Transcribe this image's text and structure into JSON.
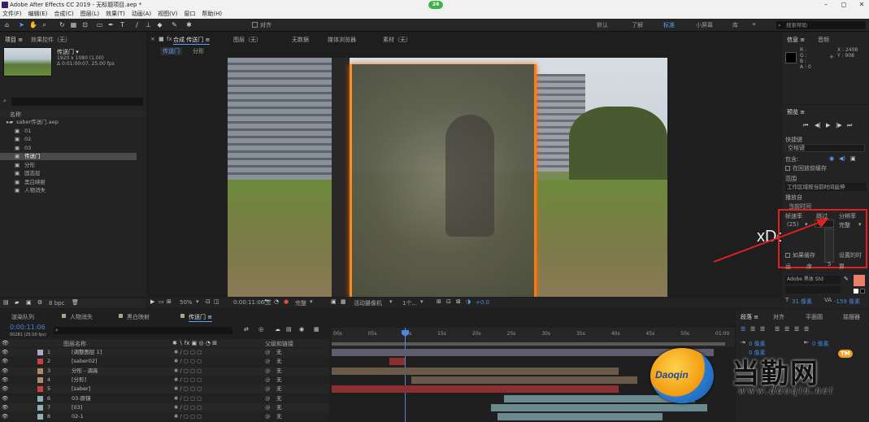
{
  "window": {
    "title": "Adobe After Effects CC 2019 - 无标题项目.aep *",
    "badge": "24"
  },
  "menu": [
    "文件(F)",
    "编辑(E)",
    "合成(C)",
    "图层(L)",
    "效果(T)",
    "动画(A)",
    "视图(V)",
    "窗口",
    "帮助(H)"
  ],
  "toolbar": {
    "align_label": "对齐",
    "workspaces": [
      "默认",
      "了解",
      "标准",
      "小屏幕",
      "库"
    ],
    "active_workspace": "标准",
    "search_placeholder": "搜索帮助"
  },
  "project_panel": {
    "tabs": [
      "项目 ≡",
      "效果控件（无）"
    ],
    "preview_name": "传送门 ▾",
    "preview_info1": "1920 x 1080 (1.00)",
    "preview_info2": "Δ 0:01:00:07, 25.00 fps",
    "col_name": "名称",
    "items": [
      {
        "name": "saber传送门.aep",
        "level": 0,
        "selected": false
      },
      {
        "name": "01",
        "level": 1,
        "selected": false
      },
      {
        "name": "02",
        "level": 1,
        "selected": false
      },
      {
        "name": "03",
        "level": 1,
        "selected": false
      },
      {
        "name": "传送门",
        "level": 1,
        "selected": true
      },
      {
        "name": "分形",
        "level": 1,
        "selected": false
      },
      {
        "name": "固态层",
        "level": 1,
        "selected": false
      },
      {
        "name": "黑白映射",
        "level": 1,
        "selected": false
      },
      {
        "name": "人物消失",
        "level": 1,
        "selected": false
      }
    ],
    "bpc": "8 bpc"
  },
  "composition": {
    "tabs": [
      "合成 传送门 ≡",
      "图层（无）",
      "无数据",
      "媒体浏览器",
      "素材（无）"
    ],
    "subtabs": [
      "传送门",
      "分形"
    ],
    "zoom": "50%",
    "timecode": "0:00:11:06",
    "resolution": "完整",
    "camera": "活动摄像机",
    "views": "1个...",
    "exposure": "+0.0"
  },
  "info_panel": {
    "tabs": [
      "信息 ≡",
      "音频"
    ],
    "rgba": [
      "R :",
      "G :",
      "B :",
      "A : 0"
    ],
    "coords": [
      "X : 2408",
      "Y : 908"
    ]
  },
  "preview_panel": {
    "title": "预览 ≡",
    "shortcut_label": "快捷键",
    "shortcut_value": "空格键",
    "include_label": "包含:",
    "cache_label": "在回放前缓存",
    "range_label": "范围",
    "range_value": "工作区域按当前时间延伸",
    "play_from_label": "播放自",
    "play_from_value": "当前时间",
    "fps_header": "帧速率",
    "skip_header": "跳过",
    "res_header": "分辨率",
    "fps_value": "(25)",
    "skip_value": "2",
    "res_value": "完整",
    "fullscreen_label": "全屏",
    "cache_check_label": "如果缓存",
    "extra_label": "设置的时",
    "adjust_label": "调",
    "bottom_labels": [
      "运",
      "序",
      "5",
      "算"
    ]
  },
  "character_panel": {
    "font_name": "Adobe 黑体 Std",
    "font_size": "31 像素",
    "tracking": "-159 像素"
  },
  "paragraph_panel": {
    "tabs": [
      "段落 ≡",
      "对齐",
      "平面圆",
      "摇摆器"
    ],
    "indent_values": [
      "0 像素",
      "0 像素",
      "0 像素"
    ]
  },
  "timeline": {
    "tabs": [
      "渲染队列",
      "人物消失",
      "黑白映射",
      "传送门 ≡"
    ],
    "timecode": "0:00:11:06",
    "timecode_sub": "00281 (25.00 fps)",
    "col_name": "图层名称",
    "col_parent": "父级和链接",
    "ruler": [
      "00s",
      "05s",
      "10s",
      "15s",
      "20s",
      "25s",
      "30s",
      "35s",
      "40s",
      "45s",
      "50s",
      "01:00"
    ],
    "layers": [
      {
        "num": "1",
        "name": "[调整图层 1]",
        "color": "#a8a8c8",
        "parent": "无",
        "bar": "#5e5e6e",
        "start": 0,
        "end": 60
      },
      {
        "num": "2",
        "name": "[saber02]",
        "color": "#c84040",
        "parent": "无",
        "bar": "#8a3030",
        "start": 9,
        "end": 11.5
      },
      {
        "num": "3",
        "name": "分形 - 调高",
        "color": "#b08870",
        "parent": "无",
        "bar": "#6a5a4a",
        "start": 0,
        "end": 45
      },
      {
        "num": "4",
        "name": "[分形]",
        "color": "#b08870",
        "parent": "无",
        "bar": "#6a5a4a",
        "start": 12.5,
        "end": 48
      },
      {
        "num": "5",
        "name": "[saber]",
        "color": "#c84040",
        "parent": "无",
        "bar": "#8a3030",
        "start": 0,
        "end": 45
      },
      {
        "num": "6",
        "name": "03-原镜",
        "color": "#8ab0b8",
        "parent": "无",
        "bar": "#6a8a90",
        "start": 27,
        "end": 57
      },
      {
        "num": "7",
        "name": "[03]",
        "color": "#8ab0b8",
        "parent": "无",
        "bar": "#6a8a90",
        "start": 25,
        "end": 59
      },
      {
        "num": "8",
        "name": "02-1",
        "color": "#8ab0b8",
        "parent": "无",
        "bar": "#6a8a90",
        "start": 26,
        "end": 52
      }
    ]
  },
  "overlay": {
    "watermark_text": "xDown.cc",
    "logo_text": "Daoqin",
    "site_cn": "当勤网",
    "site_url": "www.daoqin.net",
    "tm": "TM"
  }
}
